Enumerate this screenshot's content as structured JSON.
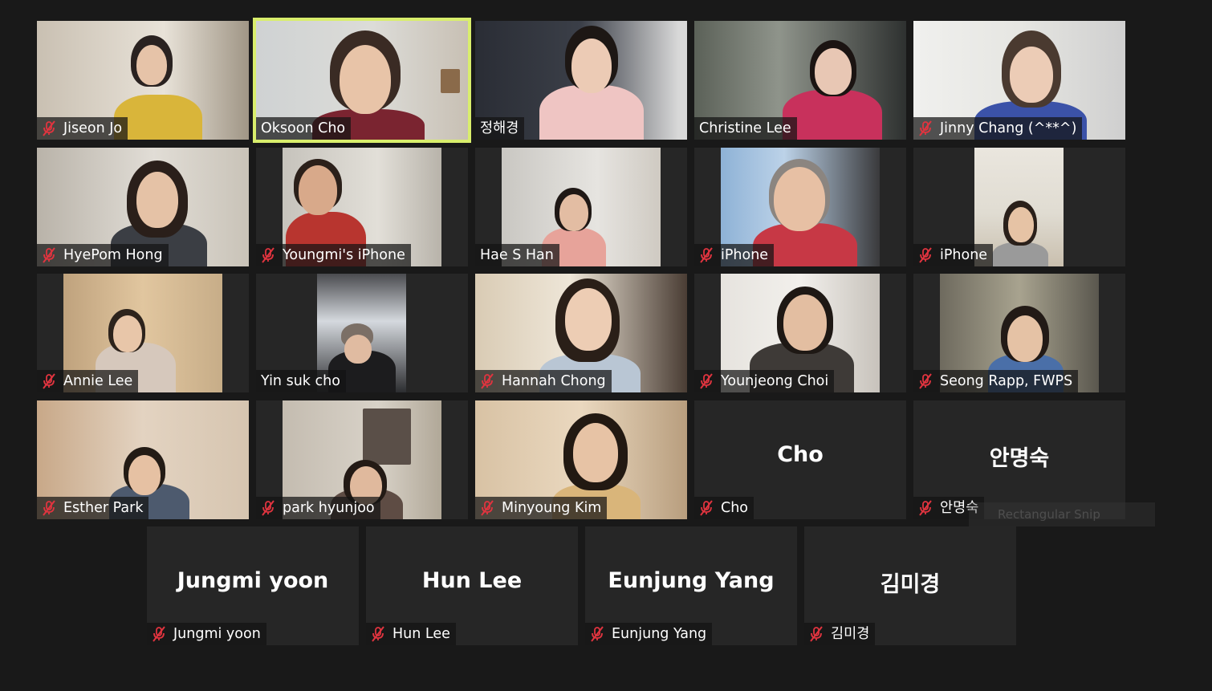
{
  "participants": [
    {
      "name": "Jiseon Jo",
      "muted": true
    },
    {
      "name": "Oksoon Cho",
      "muted": false
    },
    {
      "name": "정해경",
      "muted": false
    },
    {
      "name": "Christine Lee",
      "muted": false
    },
    {
      "name": "Jinny Chang (^**^)",
      "muted": true
    },
    {
      "name": "HyePom Hong",
      "muted": true
    },
    {
      "name": "Youngmi's iPhone",
      "muted": true
    },
    {
      "name": "Hae S Han",
      "muted": false
    },
    {
      "name": "iPhone",
      "muted": true
    },
    {
      "name": "iPhone",
      "muted": true
    },
    {
      "name": "Annie Lee",
      "muted": true
    },
    {
      "name": "Yin suk cho",
      "muted": false
    },
    {
      "name": "Hannah Chong",
      "muted": true
    },
    {
      "name": "Younjeong Choi",
      "muted": true
    },
    {
      "name": "Seong Rapp, FWPS",
      "muted": true
    },
    {
      "name": "Esther Park",
      "muted": true
    },
    {
      "name": "park hyunjoo",
      "muted": true
    },
    {
      "name": "Minyoung Kim",
      "muted": true
    },
    {
      "name": "Cho",
      "muted": true,
      "display": "Cho"
    },
    {
      "name": "안명숙",
      "muted": true,
      "display": "안명숙"
    },
    {
      "name": "Jungmi yoon",
      "muted": true,
      "display": "Jungmi yoon"
    },
    {
      "name": "Hun Lee",
      "muted": true,
      "display": "Hun Lee"
    },
    {
      "name": "Eunjung Yang",
      "muted": true,
      "display": "Eunjung Yang"
    },
    {
      "name": "김미경",
      "muted": true,
      "display": "김미경"
    }
  ],
  "ghost_overlay": "Rectangular Snip",
  "colors": {
    "background": "#191919",
    "tile": "#262626",
    "active_speaker_border": "#d9ee6c",
    "mute_icon": "#e0343f"
  }
}
